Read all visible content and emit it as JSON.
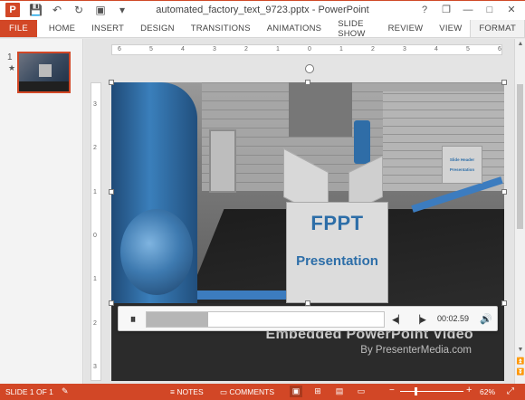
{
  "window": {
    "title": "automated_factory_text_9723.pptx - PowerPoint",
    "app_logo": "P",
    "quick_access": [
      {
        "name": "save-icon",
        "glyph": "💾"
      },
      {
        "name": "undo-icon",
        "glyph": "↶"
      },
      {
        "name": "redo-icon",
        "glyph": "↻"
      },
      {
        "name": "present-icon",
        "glyph": "▣"
      },
      {
        "name": "customize-icon",
        "glyph": "▾"
      }
    ],
    "controls": {
      "help": "?",
      "restore": "❐",
      "minimize": "—",
      "maximize": "□",
      "close": "✕"
    }
  },
  "ribbon": {
    "file": "FILE",
    "tabs": [
      "HOME",
      "INSERT",
      "DESIGN",
      "TRANSITIONS",
      "ANIMATIONS",
      "SLIDE SHOW",
      "REVIEW",
      "VIEW"
    ],
    "active_tab": "FORMAT"
  },
  "thumbnails": {
    "number": "1",
    "marker": "★"
  },
  "ruler": {
    "horizontal_ticks": [
      "6",
      "5",
      "4",
      "3",
      "2",
      "1",
      "0",
      "1",
      "2",
      "3",
      "4",
      "5",
      "6"
    ],
    "vertical_ticks": [
      "3",
      "2",
      "1",
      "0",
      "1",
      "2",
      "3"
    ]
  },
  "slide": {
    "box_title": "FPPT",
    "box_subtitle": "Presentation",
    "small_box_line1": "Slide Header",
    "small_box_line2": "Presentation",
    "embed_title": "Embedded PowerPoint Video",
    "embed_subtitle": "By PresenterMedia.com"
  },
  "video_controls": {
    "pause": "⏸",
    "progress_fraction": 0.26,
    "previous": "◀▏",
    "next": "▕▶",
    "time": "00:02.59",
    "volume": "🔊"
  },
  "status": {
    "slide_info": "SLIDE 1 OF 1",
    "notes": "NOTES",
    "comments": "COMMENTS",
    "zoom": "62%"
  },
  "colors": {
    "accent": "#d24726",
    "brand_text": "#2d6ea8"
  }
}
